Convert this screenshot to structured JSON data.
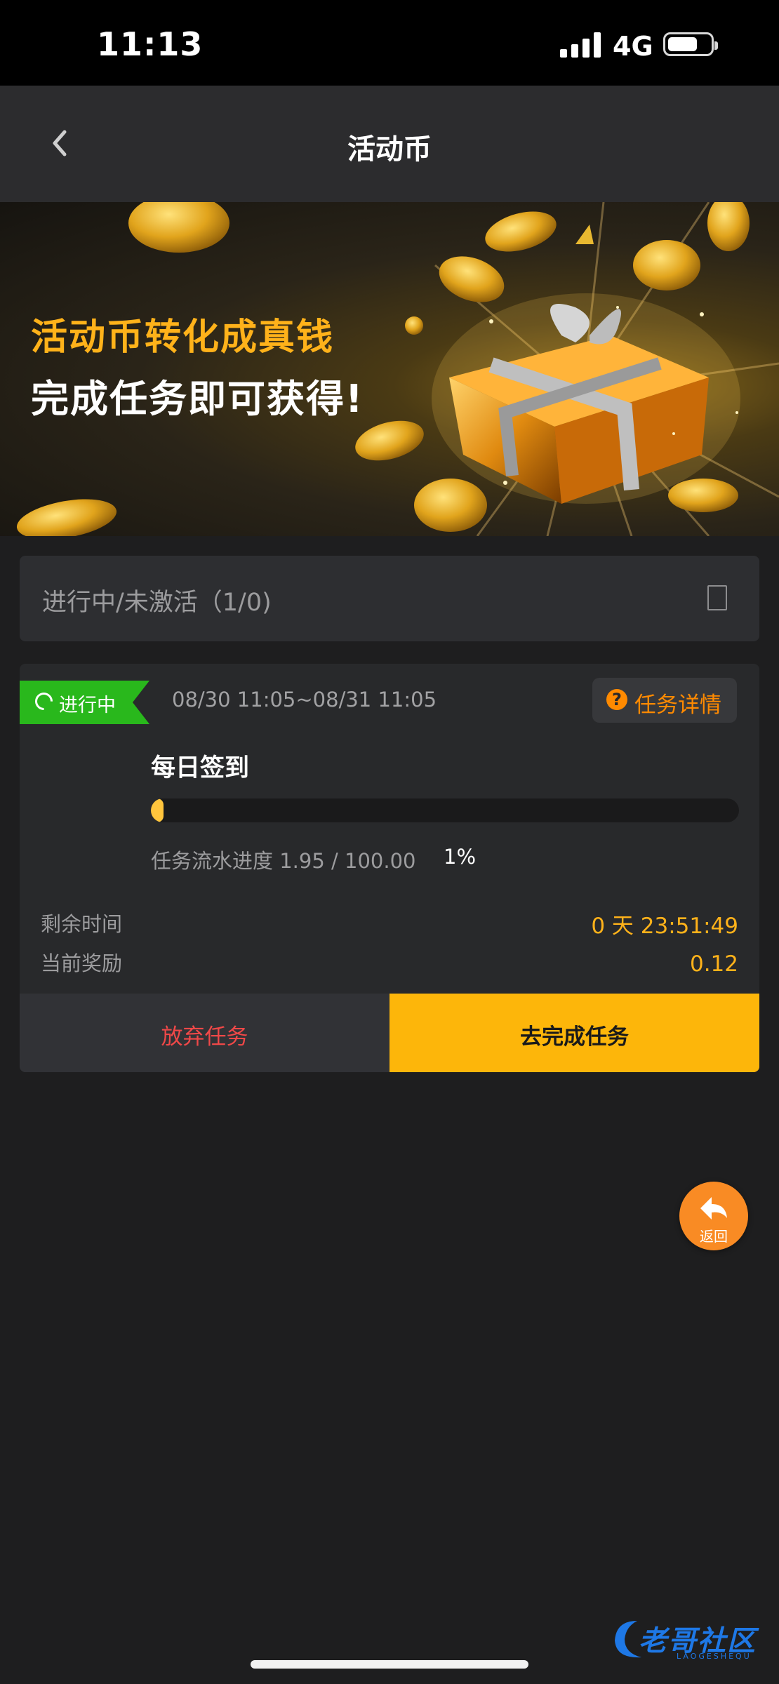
{
  "status_bar": {
    "time": "11:13",
    "network": "4G",
    "battery_level": 0.7
  },
  "header": {
    "title": "活动币"
  },
  "banner": {
    "line1": "活动币转化成真钱",
    "line2": "完成任务即可获得!"
  },
  "filter": {
    "label": "进行中/未激活（1/0)",
    "checked": false
  },
  "task": {
    "status_badge": "进行中",
    "time_range": "08/30 11:05~08/31 11:05",
    "detail_button": "任务详情",
    "name": "每日签到",
    "progress": 0.01,
    "progress_label": "任务流水进度 1.95 / 100.00",
    "progress_percent": "1%",
    "remaining_label": "剩余时间",
    "remaining_value": "0 天 23:51:49",
    "reward_label": "当前奖励",
    "reward_value": "0.12",
    "abandon_button": "放弃任务",
    "complete_button": "去完成任务"
  },
  "float_button": {
    "label": "返回"
  },
  "watermark": {
    "text": "老哥社区",
    "sub": "LAOGESHEQU"
  },
  "colors": {
    "accent": "#fdb60a",
    "status_green": "#29b81c",
    "danger": "#f04848",
    "orange": "#ff8a00"
  }
}
